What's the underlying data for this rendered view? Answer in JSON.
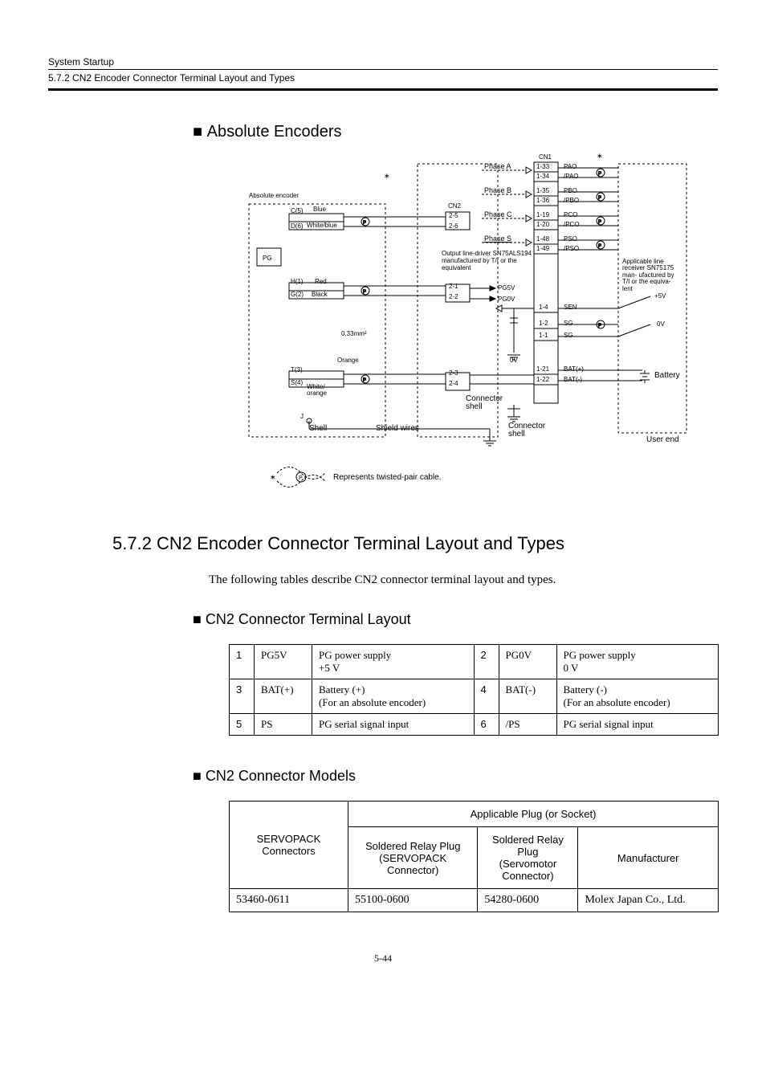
{
  "header": {
    "chapter": "System Startup",
    "section_num_title": "5.7.2 CN2 Encoder Connector Terminal Layout and Types"
  },
  "h3": "Absolute Encoders",
  "diagram": {
    "labels": {
      "abs_encoder": "Absolute encoder",
      "pg": "PG",
      "blue": "Blue",
      "white_blue": "White/blue",
      "red": "Red",
      "black": "Black",
      "orange": "Orange",
      "white_orange": "White/\norange",
      "c5": "C(5)",
      "d6": "D(6)",
      "h1": "H(1)",
      "g2": "G(2)",
      "t3": "T(3)",
      "s4": "S(4)",
      "j": "J",
      "wire_area": "0.33mm²",
      "shell": "Shell",
      "shield": "Shield wires",
      "connector_shell": "Connector\nshell",
      "cn2": "CN2",
      "cn2_25": "2-5",
      "cn2_26": "2-6",
      "cn2_21": "2-1",
      "cn2_22": "2-2",
      "cn2_23": "2-3",
      "cn2_24": "2-4",
      "phase_a": "Phase A",
      "phase_b": "Phase B",
      "phase_c": "Phase C",
      "phase_s": "Phase S",
      "driver_note": "Output line-driver\nSN75ALS194 manufactured\nby T/I or the equivalent",
      "pg5v": "PG5V",
      "pg0v": "PG0V",
      "ov": "0V",
      "cn1": "CN1",
      "cn1_133": "1-33",
      "cn1_134": "1-34",
      "cn1_135": "1-35",
      "cn1_136": "1-36",
      "cn1_119": "1-19",
      "cn1_120": "1-20",
      "cn1_148": "1-48",
      "cn1_149": "1-49",
      "cn1_14": "1-4",
      "cn1_12": "1-2",
      "cn1_11": "1-1",
      "cn1_121": "1-21",
      "cn1_122": "1-22",
      "pao": "PAO",
      "npao": "/PAO",
      "pbo": "PBO",
      "npbo": "/PBO",
      "pco": "PCO",
      "npco": "/PCO",
      "pso": "PSO",
      "npso": "/PSO",
      "sen": "SEN",
      "sg1": "SG",
      "sg2": "SG",
      "bat_p": "BAT(+)",
      "bat_m": "BAT(-)",
      "recv_note": "Applicable line\nreceiver\nSN75175 man-\nufactured by T/I\nor the equiva-\nlent",
      "plus5v": "+5V",
      "zero_v": "0V",
      "battery": "Battery",
      "user_end": "User end",
      "tp_note": "Represents twisted-pair cable.",
      "p_label": "P"
    }
  },
  "h2": "5.7.2  CN2 Encoder Connector Terminal Layout and Types",
  "intro_p": "The following tables describe CN2 connector terminal layout and types.",
  "sub1": "CN2 Connector Terminal Layout",
  "table1": {
    "rows": [
      {
        "n1": "1",
        "s1": "PG5V",
        "d1": "PG power supply\n+5 V",
        "n2": "2",
        "s2": "PG0V",
        "d2": "PG power supply\n0 V"
      },
      {
        "n1": "3",
        "s1": "BAT(+)",
        "d1": "Battery (+)\n(For an absolute encoder)",
        "n2": "4",
        "s2": "BAT(-)",
        "d2": "Battery (-)\n(For an absolute encoder)"
      },
      {
        "n1": "5",
        "s1": "PS",
        "d1": "PG serial signal input",
        "n2": "6",
        "s2": "/PS",
        "d2": "PG serial signal input"
      }
    ]
  },
  "sub2": "CN2 Connector Models",
  "table2": {
    "head": {
      "c1": "SERVOPACK\nConnectors",
      "span_top": "Applicable Plug (or Socket)",
      "c2": "Soldered Relay Plug\n(SERVOPACK\nConnector)",
      "c3": "Soldered Relay\nPlug\n(Servomotor\nConnector)",
      "c4": "Manufacturer"
    },
    "row": {
      "c1": "53460-0611",
      "c2": "55100-0600",
      "c3": "54280-0600",
      "c4": "Molex Japan Co., Ltd."
    }
  },
  "footer": "5-44"
}
